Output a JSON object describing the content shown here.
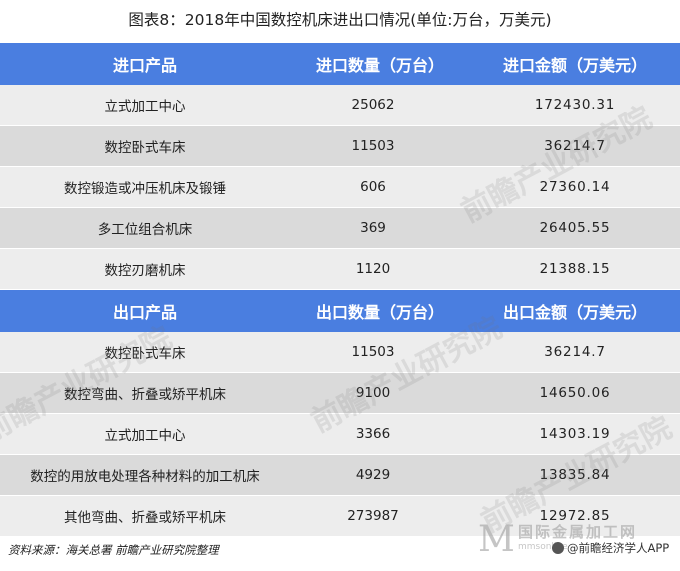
{
  "title": "图表8：2018年中国数控机床进出口情况(单位:万台，万美元)",
  "import_header": [
    "进口产品",
    "进口数量（万台）",
    "进口金额（万美元）"
  ],
  "import_rows": [
    [
      "立式加工中心",
      "25062",
      "172430.31"
    ],
    [
      "数控卧式车床",
      "11503",
      "36214.7"
    ],
    [
      "数控锻造或冲压机床及锻锤",
      "606",
      "27360.14"
    ],
    [
      "多工位组合机床",
      "369",
      "26405.55"
    ],
    [
      "数控刃磨机床",
      "1120",
      "21388.15"
    ]
  ],
  "export_header": [
    "出口产品",
    "出口数量（万台）",
    "出口金额（万美元）"
  ],
  "export_rows": [
    [
      "数控卧式车床",
      "11503",
      "36214.7"
    ],
    [
      "数控弯曲、折叠或矫平机床",
      "9100",
      "14650.06"
    ],
    [
      "立式加工中心",
      "3366",
      "14303.19"
    ],
    [
      "数控的用放电处理各种材料的加工机床",
      "4929",
      "13835.84"
    ],
    [
      "其他弯曲、折叠或矫平机床",
      "273987",
      "12972.85"
    ]
  ],
  "source": "资料来源：海关总署 前瞻产业研究院整理",
  "watermark": "前瞻产业研究院",
  "brand": {
    "logo": "M",
    "cn": "国际金属加工网",
    "en": "mmsonline",
    "app": "@前瞻经济学人APP"
  },
  "colors": {
    "header_bg": "#4a7ee0",
    "row_light": "#ededed",
    "row_dark": "#dadada"
  }
}
